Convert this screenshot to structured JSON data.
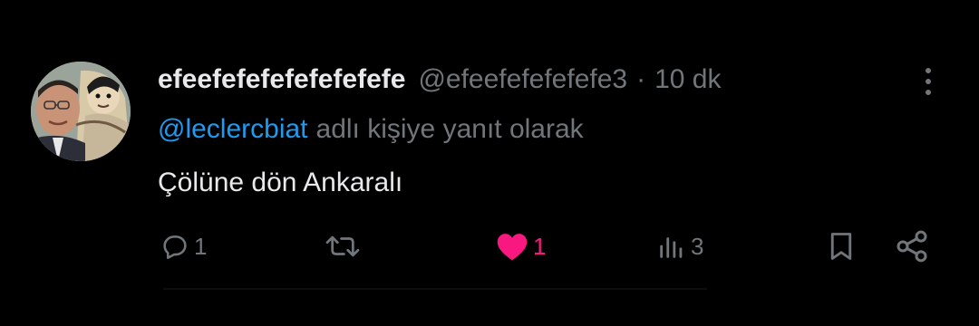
{
  "tweet": {
    "display_name": "efeefefefefefefefefe",
    "handle": "@efeefefefefefe3",
    "separator": "·",
    "time": "10 dk",
    "reply_mention": "@leclercbiat",
    "reply_suffix": "adlı kişiye yanıt olarak",
    "text": "Çölüne dön Ankaralı"
  },
  "actions": {
    "reply": {
      "icon": "reply-icon",
      "count": "1"
    },
    "retweet": {
      "icon": "retweet-icon",
      "count": ""
    },
    "like": {
      "icon": "heart-icon",
      "count": "1",
      "color": "#f91880",
      "liked": true
    },
    "views": {
      "icon": "views-icon",
      "count": "3"
    },
    "bookmark": {
      "icon": "bookmark-icon"
    },
    "share": {
      "icon": "share-icon"
    }
  },
  "colors": {
    "background": "#000000",
    "text_primary": "#e7e9ea",
    "text_secondary": "#71767b",
    "link": "#1d9bf0",
    "like": "#f91880"
  }
}
